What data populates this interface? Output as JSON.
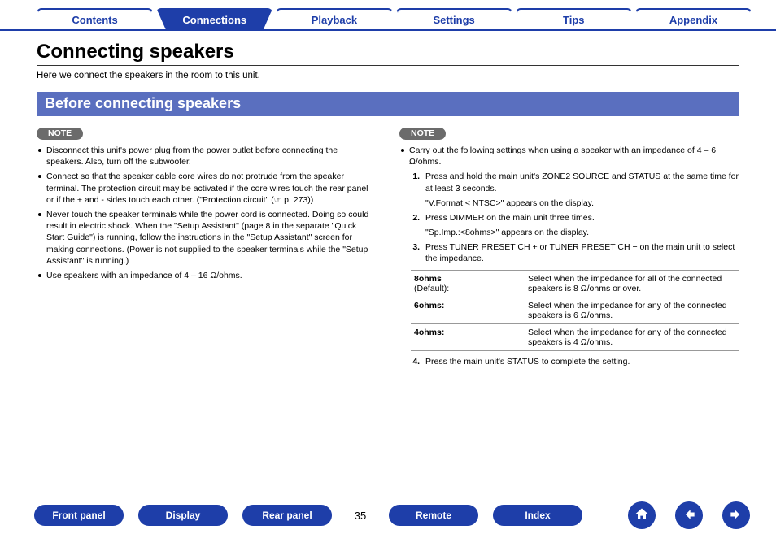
{
  "tabs": {
    "contents": "Contents",
    "connections": "Connections",
    "playback": "Playback",
    "settings": "Settings",
    "tips": "Tips",
    "appendix": "Appendix"
  },
  "page": {
    "title": "Connecting speakers",
    "intro": "Here we connect the speakers in the room to this unit.",
    "section_heading": "Before connecting speakers"
  },
  "left_note": {
    "label": "NOTE",
    "b1": "Disconnect this unit's power plug from the power outlet before connecting the speakers. Also, turn off the subwoofer.",
    "b2_a": "Connect so that the speaker cable core wires do not protrude from the speaker terminal. The protection circuit may be activated if the core wires touch the rear panel or if the + and - sides touch each other. (\"Protection circuit\" (",
    "b2_link": "p. 273",
    "b2_b": "))",
    "b3": "Never touch the speaker terminals while the power cord is connected. Doing so could result in electric shock. When the \"Setup Assistant\" (page 8 in the separate \"Quick Start Guide\") is running, follow the instructions in the \"Setup Assistant\" screen for making connections. (Power is not supplied to the speaker terminals while the \"Setup Assistant\" is running.)",
    "b4": "Use speakers with an impedance of 4 – 16 Ω/ohms."
  },
  "right_note": {
    "label": "NOTE",
    "b1": "Carry out the following settings when using a speaker with an impedance of 4 – 6 Ω/ohms.",
    "s1": "Press and hold the main unit's ZONE2 SOURCE and STATUS at the same time for at least 3 seconds.",
    "s1_sub": "\"V.Format:< NTSC>\" appears on the display.",
    "s2": "Press DIMMER on the main unit three times.",
    "s2_sub": "\"Sp.Imp.:<8ohms>\" appears on the display.",
    "s3": "Press TUNER PRESET CH + or TUNER PRESET CH − on the main unit to select the impedance.",
    "s4": "Press the main unit's STATUS to complete the setting."
  },
  "imp_table": {
    "r1_label": "8ohms",
    "r1_sub": "(Default):",
    "r1_desc": "Select when the impedance for all of the connected speakers is 8 Ω/ohms or over.",
    "r2_label": "6ohms:",
    "r2_desc": "Select when the impedance for any of the connected speakers is 6 Ω/ohms.",
    "r3_label": "4ohms:",
    "r3_desc": "Select when the impedance for any of the connected speakers is 4 Ω/ohms."
  },
  "footer": {
    "front_panel": "Front panel",
    "display": "Display",
    "rear_panel": "Rear panel",
    "page_num": "35",
    "remote": "Remote",
    "index": "Index"
  }
}
